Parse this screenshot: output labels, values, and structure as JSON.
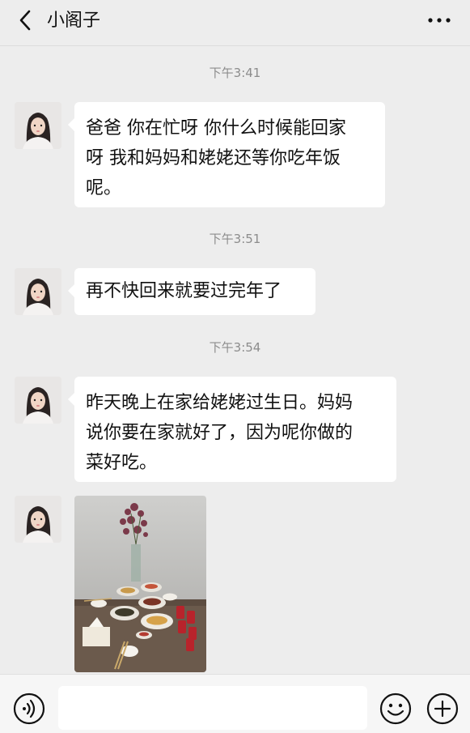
{
  "header": {
    "title": "小阁子",
    "back_icon": "chevron-left-icon",
    "more_icon": "more-horizontal-icon"
  },
  "messages": [
    {
      "time": "下午3:41",
      "lines": [
        "爸爸 你在忙呀 你什么时候能回家",
        "呀 我和妈妈和姥姥还等你吃年饭",
        "呢。"
      ]
    },
    {
      "time": "下午3:51",
      "lines": [
        "再不快回来就要过完年了"
      ]
    },
    {
      "time": "下午3:54",
      "lines": [
        "昨天晚上在家给姥姥过生日。妈妈",
        "说你要在家就好了，因为呢你做的",
        "菜好吃。"
      ]
    }
  ],
  "input": {
    "value": "",
    "voice_icon": "voice-icon",
    "emoji_icon": "emoji-icon",
    "add_icon": "plus-circle-icon"
  }
}
